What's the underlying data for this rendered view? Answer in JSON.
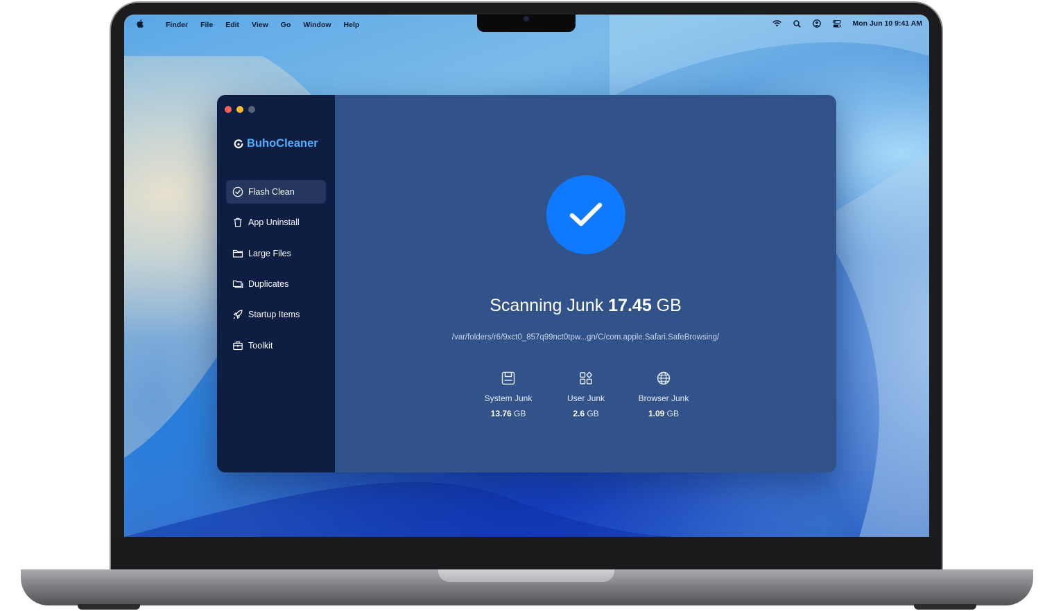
{
  "menubar": {
    "items": [
      "Finder",
      "File",
      "Edit",
      "View",
      "Go",
      "Window",
      "Help"
    ],
    "datetime": "Mon Jun 10  9:41 AM"
  },
  "app": {
    "brand": "BuhoCleaner",
    "nav": [
      {
        "label": "Flash Clean",
        "icon": "check-circle-icon",
        "active": true
      },
      {
        "label": "App Uninstall",
        "icon": "trash-icon",
        "active": false
      },
      {
        "label": "Large Files",
        "icon": "folder-icon",
        "active": false
      },
      {
        "label": "Duplicates",
        "icon": "folders-icon",
        "active": false
      },
      {
        "label": "Startup Items",
        "icon": "rocket-icon",
        "active": false
      },
      {
        "label": "Toolkit",
        "icon": "toolbox-icon",
        "active": false
      }
    ],
    "scan": {
      "prefix": "Scanning Junk",
      "amount": "17.45",
      "unit": "GB",
      "path": "/var/folders/r6/9xct0_857q99nct0tpw...gn/C/com.apple.Safari.SafeBrowsing/"
    },
    "stats": [
      {
        "label": "System Junk",
        "value": "13.76",
        "unit": "GB",
        "icon": "disk-icon"
      },
      {
        "label": "User Junk",
        "value": "2.6",
        "unit": "GB",
        "icon": "apps-grid-icon"
      },
      {
        "label": "Browser Junk",
        "value": "1.09",
        "unit": "GB",
        "icon": "globe-icon"
      }
    ]
  },
  "colors": {
    "sidebar": "#0e1d42",
    "main": "#32528a",
    "accent": "#0f7aff",
    "brand": "#4fb1ff"
  }
}
